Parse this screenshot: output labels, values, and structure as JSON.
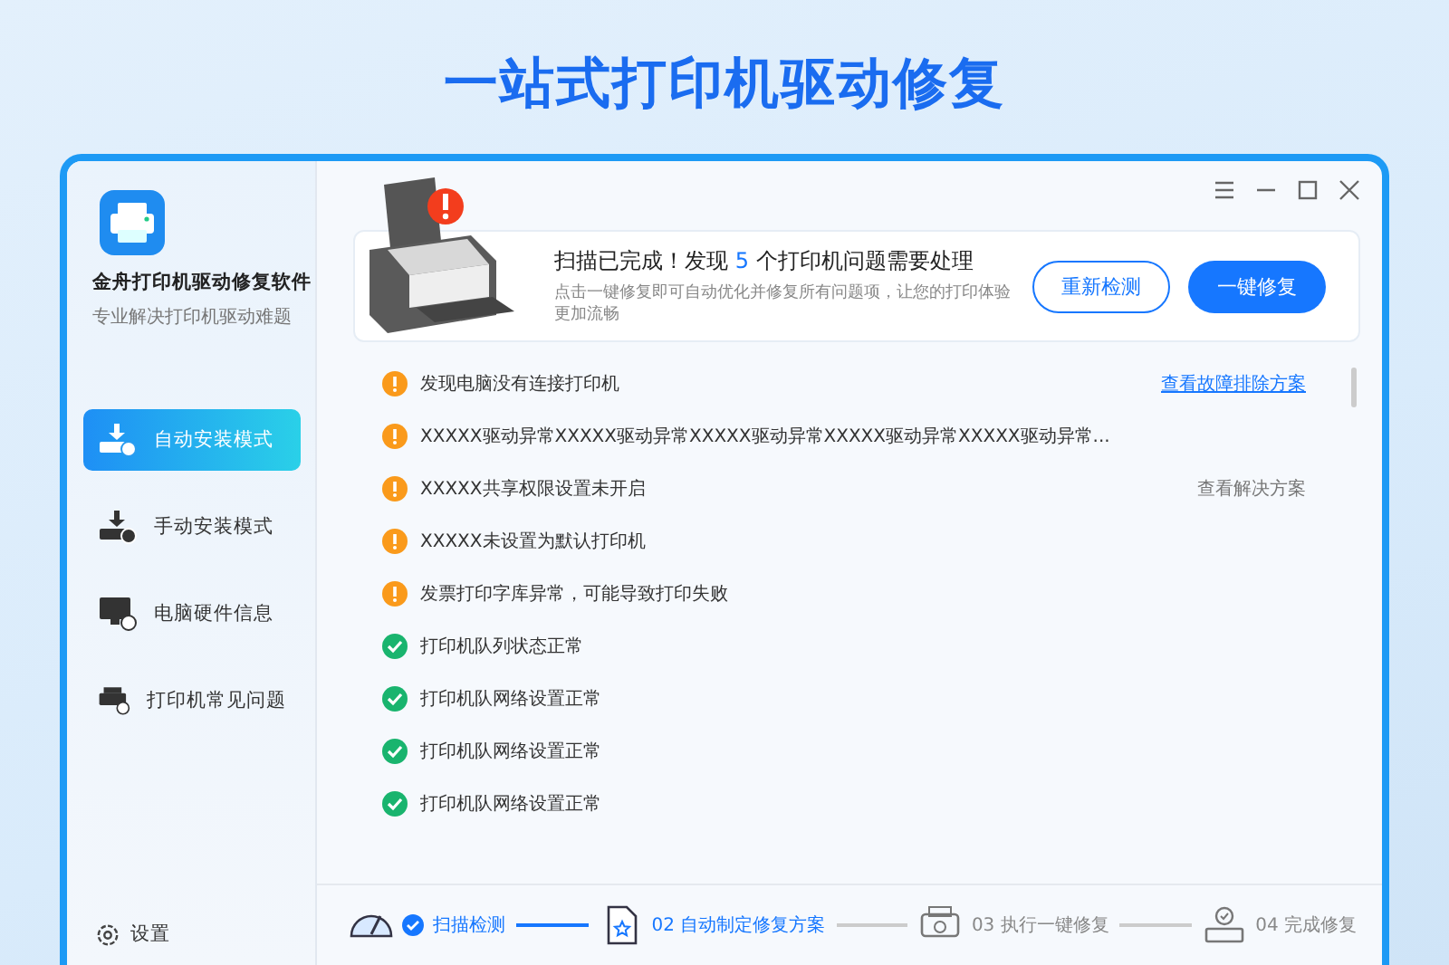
{
  "headline": "一站式打印机驱动修复",
  "app": {
    "name": "金舟打印机驱动修复软件",
    "tagline": "专业解决打印机驱动难题"
  },
  "sidebar": {
    "items": [
      {
        "label": "自动安装模式",
        "kind": "auto",
        "selected": true
      },
      {
        "label": "手动安装模式",
        "kind": "manual",
        "selected": false
      },
      {
        "label": "电脑硬件信息",
        "kind": "hardware",
        "selected": false
      },
      {
        "label": "打印机常见问题",
        "kind": "faq",
        "selected": false
      }
    ],
    "settings": "设置"
  },
  "summary": {
    "title_before": "扫描已完成！发现",
    "count": "5",
    "title_after": "个打印机问题需要处理",
    "description": "点击一键修复即可自动优化并修复所有问题项，让您的打印体验更加流畅",
    "buttons": [
      {
        "label": "重新检测",
        "kind": "outline"
      },
      {
        "label": "一键修复",
        "kind": "primary"
      }
    ]
  },
  "results": [
    {
      "text": "发现电脑没有连接打印机",
      "ok": false,
      "action": {
        "label": "查看故障排除方案",
        "kind": "link"
      }
    },
    {
      "text": "XXXXX驱动异常XXXXX驱动异常XXXXX驱动异常XXXXX驱动异常XXXXX驱动异常...",
      "ok": false
    },
    {
      "text": "XXXXX共享权限设置未开启",
      "ok": false,
      "action": {
        "label": "查看解决方案",
        "kind": "plain"
      }
    },
    {
      "text": "XXXXX未设置为默认打印机",
      "ok": false
    },
    {
      "text": "发票打印字库异常，可能导致打印失败",
      "ok": false
    },
    {
      "text": "打印机队列状态正常",
      "ok": true
    },
    {
      "text": "打印机队网络设置正常",
      "ok": true
    },
    {
      "text": "打印机队网络设置正常",
      "ok": true
    },
    {
      "text": "打印机队网络设置正常",
      "ok": true
    }
  ],
  "steps": [
    {
      "label": "扫描检测",
      "done": true,
      "active": true,
      "kind": "gauge"
    },
    {
      "label": "02 自动制定修复方案",
      "done": false,
      "active": true,
      "kind": "document"
    },
    {
      "label": "03 执行一键修复",
      "done": false,
      "active": false,
      "kind": "printer"
    },
    {
      "label": "04 完成修复",
      "done": false,
      "active": false,
      "kind": "finish"
    }
  ]
}
